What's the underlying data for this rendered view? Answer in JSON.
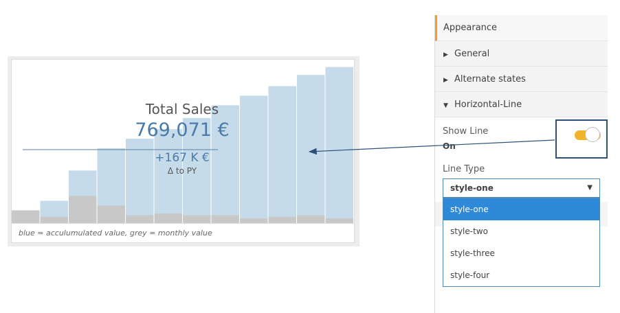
{
  "kpi": {
    "title": "Total Sales",
    "value": "769,071 €",
    "delta": "+167 K €",
    "delta_label": "Δ to PY"
  },
  "footnote": "blue = acculumulated value, grey = monthly value",
  "chart_data": {
    "type": "bar",
    "series": [
      {
        "values": [
          0.08,
          0.14,
          0.33,
          0.47,
          0.53,
          0.59,
          0.66,
          0.74,
          0.8,
          0.86,
          0.93,
          0.98
        ]
      },
      {
        "values": [
          0.08,
          0.04,
          0.17,
          0.11,
          0.05,
          0.06,
          0.05,
          0.05,
          0.03,
          0.04,
          0.05,
          0.03
        ]
      }
    ],
    "colors": {
      "accumulated": "#c5dbea",
      "monthly": "#c8c8c8"
    },
    "reference_line": true
  },
  "panel": {
    "header": "Appearance",
    "sections": {
      "general": "General",
      "alternate": "Alternate states",
      "hline": "Horizontal-Line"
    },
    "show_line": {
      "label": "Show Line",
      "value": "On",
      "enabled": true
    },
    "line_type": {
      "label": "Line Type",
      "selected": "style-one",
      "options": [
        "style-one",
        "style-two",
        "style-three",
        "style-four"
      ]
    }
  },
  "colors": {
    "accent": "#f0a124",
    "toggle": "#f0b429",
    "selection": "#2e8ad8",
    "link": "#2c4f7a"
  },
  "icons": {
    "collapsed": "triangle-right-icon",
    "expanded": "triangle-down-icon",
    "caret": "caret-down-icon"
  }
}
